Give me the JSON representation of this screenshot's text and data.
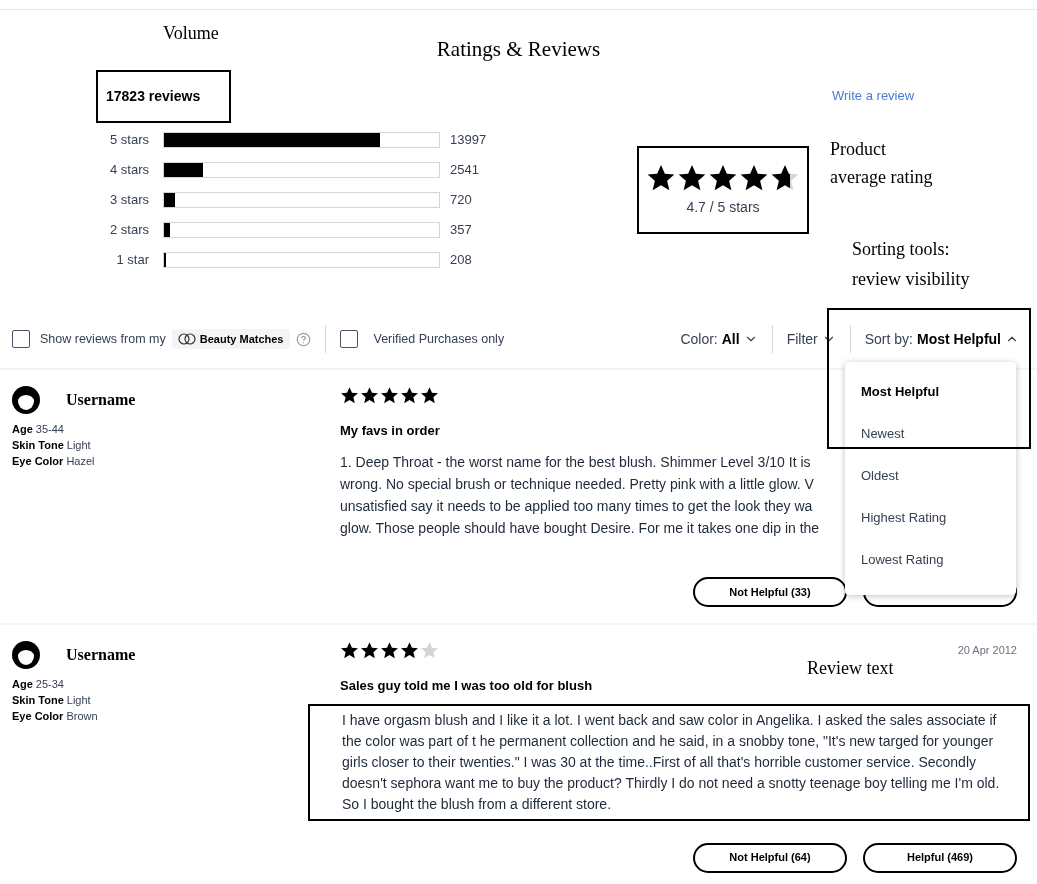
{
  "annotations": {
    "volume": "Volume",
    "average": [
      "Product",
      "average rating"
    ],
    "sorting": [
      "Sorting tools:",
      "review visibility"
    ],
    "review_text": "Review text"
  },
  "heading": "Ratings & Reviews",
  "summary": {
    "total": "17823 reviews",
    "write_link": "Write a review",
    "stars": 4.7,
    "average_label": "4.7 / 5 stars",
    "histogram": [
      {
        "label": "5 stars",
        "level": 0.785,
        "count": "13997"
      },
      {
        "label": "4 stars",
        "level": 0.143,
        "count": "2541"
      },
      {
        "label": "3 stars",
        "level": 0.04,
        "count": "720"
      },
      {
        "label": "2 stars",
        "level": 0.02,
        "count": "357"
      },
      {
        "label": "1 star",
        "level": 0.008,
        "count": "208"
      }
    ]
  },
  "filters": {
    "beauty_matches": {
      "label": "Show reviews from my",
      "badge": "Beauty Matches",
      "checked": false
    },
    "verified": {
      "label": "Verified Purchases only",
      "checked": false
    },
    "color": {
      "label": "Color:",
      "value": "All"
    },
    "filter": "Filter",
    "sort": {
      "label": "Sort by:",
      "value": "Most Helpful",
      "expanded": true,
      "options": [
        {
          "label": "Most Helpful",
          "selected": true
        },
        {
          "label": "Newest",
          "selected": false
        },
        {
          "label": "Oldest",
          "selected": false
        },
        {
          "label": "Highest Rating",
          "selected": false
        },
        {
          "label": "Lowest Rating",
          "selected": false
        }
      ]
    }
  },
  "reviews": [
    {
      "username": "Username",
      "details": [
        {
          "label": "Age",
          "value": "35-44"
        },
        {
          "label": "Skin Tone",
          "value": "Light"
        },
        {
          "label": "Eye Color",
          "value": "Hazel"
        }
      ],
      "stars": 5,
      "title": "My favs in order",
      "text_lines": [
        "1. Deep Throat - the worst name for the best blush. Shimmer Level 3/10 It is",
        "wrong. No special brush or technique needed. Pretty pink with a little glow. V",
        "unsatisfied say it needs to be applied too many times to get the look they wa",
        "glow. Those people should have bought Desire. For me it takes one dip in the"
      ],
      "not_helpful": "Not Helpful (33)"
    },
    {
      "username": "Username",
      "details": [
        {
          "label": "Age",
          "value": "25-34"
        },
        {
          "label": "Skin Tone",
          "value": "Light"
        },
        {
          "label": "Eye Color",
          "value": "Brown"
        }
      ],
      "stars": 4,
      "date": "20 Apr 2012",
      "title": "Sales guy told me I was too old for blush",
      "text": "I have orgasm blush and I like it a lot. I went back and saw color in Angelika. I asked the sales associate if the color was part of t he permanent collection and he said, in a snobby tone, \"It's new targed for younger girls closer to their twenties.\" I was 30 at the time..First of all that's horrible customer service. Secondly doesn't sephora want me to buy the product? Thirdly I do not need a snotty teenage boy telling me I'm old. So I bought the blush from a different store.",
      "not_helpful": "Not Helpful (64)",
      "helpful": "Helpful (469)"
    }
  ]
}
